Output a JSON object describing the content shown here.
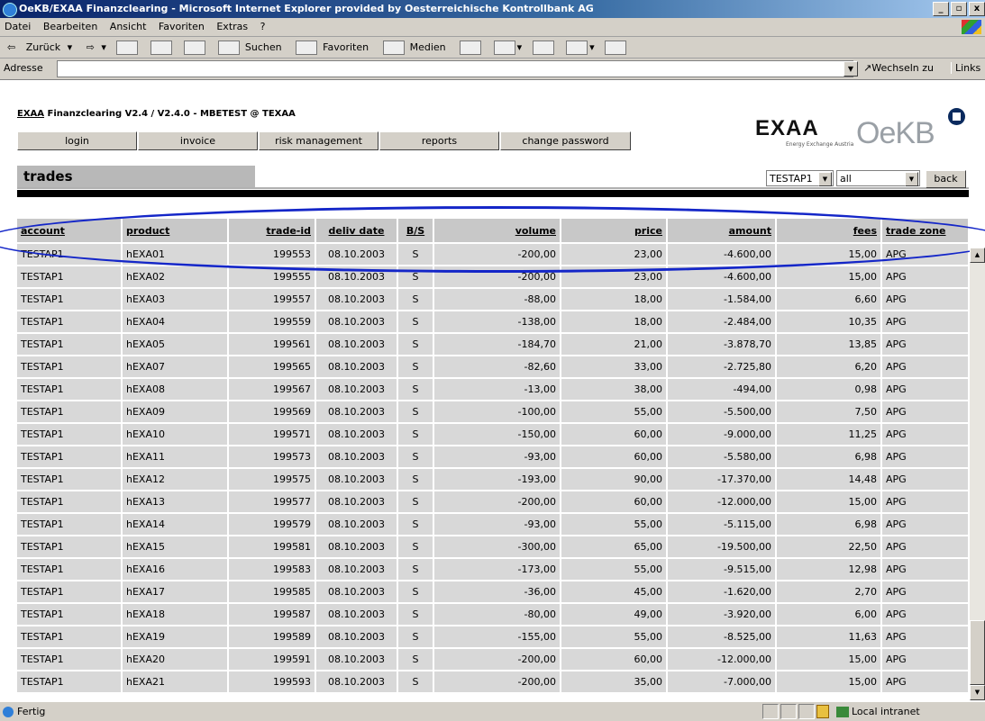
{
  "window": {
    "title": "OeKB/EXAA Finanzclearing - Microsoft Internet Explorer provided by Oesterreichische Kontrollbank AG",
    "controls": [
      "_",
      "▫",
      "x"
    ]
  },
  "menu": [
    "Datei",
    "Bearbeiten",
    "Ansicht",
    "Favoriten",
    "Extras",
    "?"
  ],
  "toolbar": {
    "back": "Zurück",
    "search": "Suchen",
    "favorites": "Favoriten",
    "media": "Medien"
  },
  "address": {
    "label": "Adresse",
    "value": "",
    "go": "Wechseln zu",
    "links": "Links"
  },
  "app": {
    "title_prefix": "EXAA",
    "title_rest": " Finanzclearing V2.4 / V2.4.0 - MBETEST @ TEXAA",
    "nav": [
      "login",
      "invoice",
      "risk management",
      "reports",
      "change password"
    ],
    "logo_exaa": "EXAA",
    "logo_exaa_sub": "Energy Exchange Austria",
    "logo_oekb": "OeKB",
    "section": "trades",
    "account_select": "TESTAP1",
    "filter_select": "all",
    "back": "back"
  },
  "table": {
    "headers": [
      "account",
      "product",
      "trade-id",
      "deliv date",
      "B/S",
      "volume",
      "price",
      "amount",
      "fees",
      "trade zone"
    ],
    "rows": [
      [
        "TESTAP1",
        "hEXA01",
        "199553",
        "08.10.2003",
        "S",
        "-200,00",
        "23,00",
        "-4.600,00",
        "15,00",
        "APG"
      ],
      [
        "TESTAP1",
        "hEXA02",
        "199555",
        "08.10.2003",
        "S",
        "-200,00",
        "23,00",
        "-4.600,00",
        "15,00",
        "APG"
      ],
      [
        "TESTAP1",
        "hEXA03",
        "199557",
        "08.10.2003",
        "S",
        "-88,00",
        "18,00",
        "-1.584,00",
        "6,60",
        "APG"
      ],
      [
        "TESTAP1",
        "hEXA04",
        "199559",
        "08.10.2003",
        "S",
        "-138,00",
        "18,00",
        "-2.484,00",
        "10,35",
        "APG"
      ],
      [
        "TESTAP1",
        "hEXA05",
        "199561",
        "08.10.2003",
        "S",
        "-184,70",
        "21,00",
        "-3.878,70",
        "13,85",
        "APG"
      ],
      [
        "TESTAP1",
        "hEXA07",
        "199565",
        "08.10.2003",
        "S",
        "-82,60",
        "33,00",
        "-2.725,80",
        "6,20",
        "APG"
      ],
      [
        "TESTAP1",
        "hEXA08",
        "199567",
        "08.10.2003",
        "S",
        "-13,00",
        "38,00",
        "-494,00",
        "0,98",
        "APG"
      ],
      [
        "TESTAP1",
        "hEXA09",
        "199569",
        "08.10.2003",
        "S",
        "-100,00",
        "55,00",
        "-5.500,00",
        "7,50",
        "APG"
      ],
      [
        "TESTAP1",
        "hEXA10",
        "199571",
        "08.10.2003",
        "S",
        "-150,00",
        "60,00",
        "-9.000,00",
        "11,25",
        "APG"
      ],
      [
        "TESTAP1",
        "hEXA11",
        "199573",
        "08.10.2003",
        "S",
        "-93,00",
        "60,00",
        "-5.580,00",
        "6,98",
        "APG"
      ],
      [
        "TESTAP1",
        "hEXA12",
        "199575",
        "08.10.2003",
        "S",
        "-193,00",
        "90,00",
        "-17.370,00",
        "14,48",
        "APG"
      ],
      [
        "TESTAP1",
        "hEXA13",
        "199577",
        "08.10.2003",
        "S",
        "-200,00",
        "60,00",
        "-12.000,00",
        "15,00",
        "APG"
      ],
      [
        "TESTAP1",
        "hEXA14",
        "199579",
        "08.10.2003",
        "S",
        "-93,00",
        "55,00",
        "-5.115,00",
        "6,98",
        "APG"
      ],
      [
        "TESTAP1",
        "hEXA15",
        "199581",
        "08.10.2003",
        "S",
        "-300,00",
        "65,00",
        "-19.500,00",
        "22,50",
        "APG"
      ],
      [
        "TESTAP1",
        "hEXA16",
        "199583",
        "08.10.2003",
        "S",
        "-173,00",
        "55,00",
        "-9.515,00",
        "12,98",
        "APG"
      ],
      [
        "TESTAP1",
        "hEXA17",
        "199585",
        "08.10.2003",
        "S",
        "-36,00",
        "45,00",
        "-1.620,00",
        "2,70",
        "APG"
      ],
      [
        "TESTAP1",
        "hEXA18",
        "199587",
        "08.10.2003",
        "S",
        "-80,00",
        "49,00",
        "-3.920,00",
        "6,00",
        "APG"
      ],
      [
        "TESTAP1",
        "hEXA19",
        "199589",
        "08.10.2003",
        "S",
        "-155,00",
        "55,00",
        "-8.525,00",
        "11,63",
        "APG"
      ],
      [
        "TESTAP1",
        "hEXA20",
        "199591",
        "08.10.2003",
        "S",
        "-200,00",
        "60,00",
        "-12.000,00",
        "15,00",
        "APG"
      ],
      [
        "TESTAP1",
        "hEXA21",
        "199593",
        "08.10.2003",
        "S",
        "-200,00",
        "35,00",
        "-7.000,00",
        "15,00",
        "APG"
      ]
    ]
  },
  "status": {
    "text": "Fertig",
    "zone": "Local intranet"
  },
  "colors": {
    "titlebar": "#0a246a",
    "highlight_ellipse": "#1426c8",
    "exaa_accent": "#c8102e"
  }
}
